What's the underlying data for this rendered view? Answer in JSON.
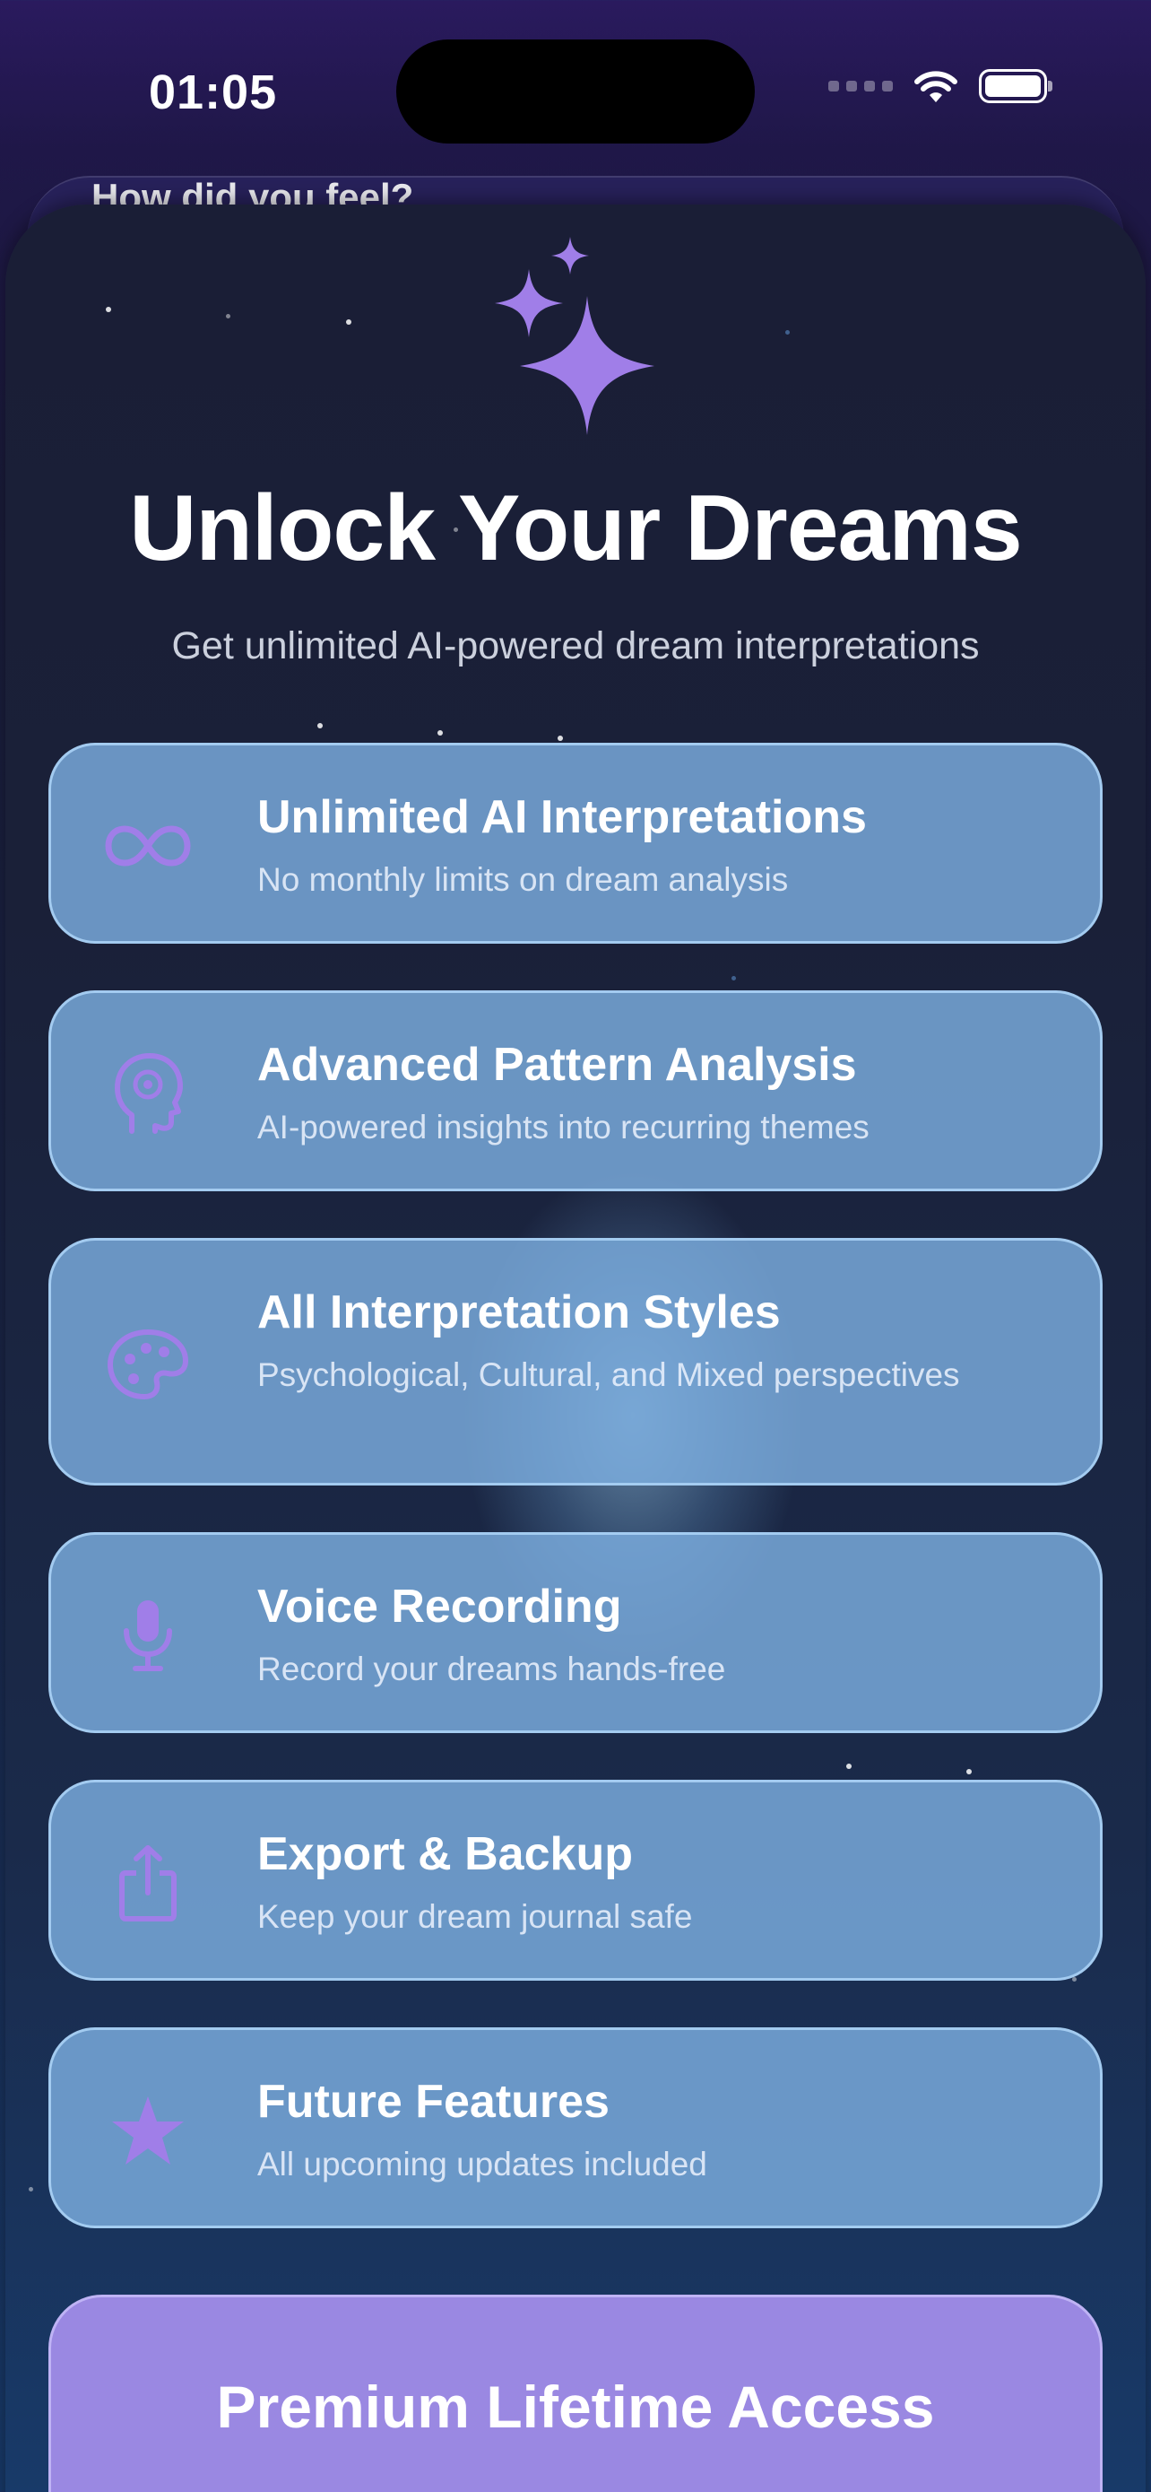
{
  "status_bar": {
    "time": "01:05"
  },
  "background_screen": {
    "partial_text": "How did you feel?"
  },
  "paywall": {
    "title": "Unlock Your Dreams",
    "subtitle": "Get unlimited AI-powered dream interpretations",
    "header_icon": "sparkles-icon",
    "accent_color": "#a07ee8",
    "card_color": "#7dafe1",
    "features": [
      {
        "icon": "infinity-icon",
        "title": "Unlimited AI Interpretations",
        "description": "No monthly limits on dream analysis"
      },
      {
        "icon": "brain-head-icon",
        "title": "Advanced Pattern Analysis",
        "description": "AI-powered insights into recurring themes"
      },
      {
        "icon": "palette-icon",
        "title": "All Interpretation Styles",
        "description": "Psychological, Cultural, and Mixed perspectives"
      },
      {
        "icon": "microphone-icon",
        "title": "Voice Recording",
        "description": "Record your dreams hands-free"
      },
      {
        "icon": "share-export-icon",
        "title": "Export & Backup",
        "description": "Keep your dream journal safe"
      },
      {
        "icon": "star-icon",
        "title": "Future Features",
        "description": "All upcoming updates included"
      }
    ],
    "purchase_button": {
      "label": "Premium Lifetime Access",
      "color": "#9a88e2"
    }
  }
}
